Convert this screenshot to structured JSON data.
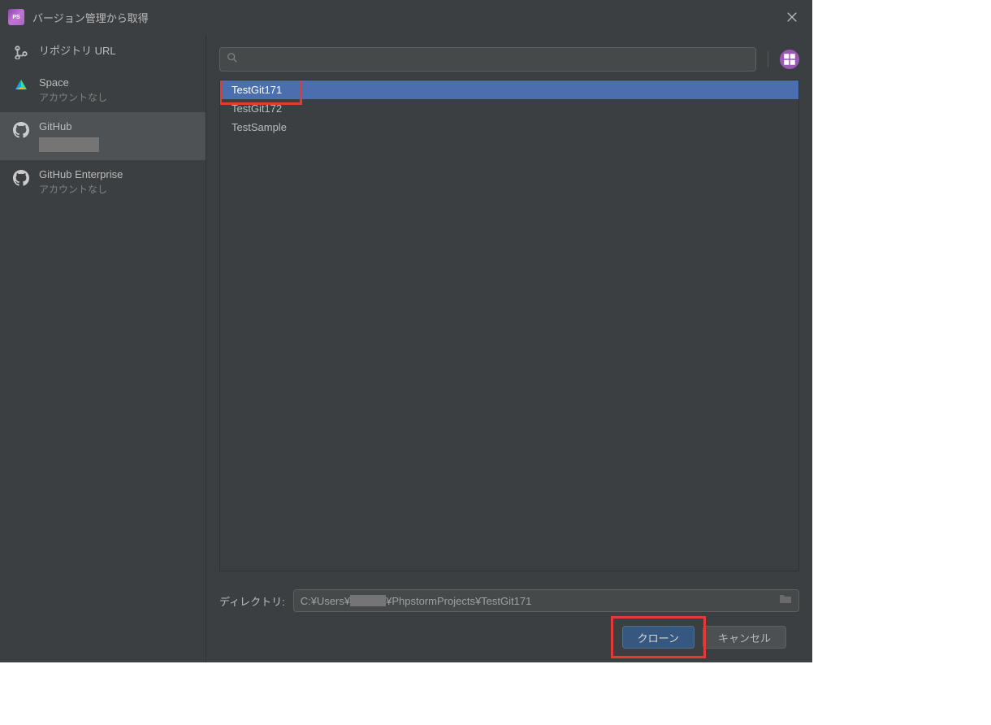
{
  "dialog": {
    "title": "バージョン管理から取得"
  },
  "sidebar": {
    "items": [
      {
        "id": "repo-url",
        "title": "リポジトリ URL",
        "sub": null,
        "selected": false,
        "icon": "branch"
      },
      {
        "id": "space",
        "title": "Space",
        "sub": "アカウントなし",
        "selected": false,
        "icon": "space"
      },
      {
        "id": "github",
        "title": "GitHub",
        "sub": null,
        "selected": true,
        "icon": "github",
        "hasAccountPlaceholder": true
      },
      {
        "id": "github-ent",
        "title": "GitHub Enterprise",
        "sub": "アカウントなし",
        "selected": false,
        "icon": "github"
      }
    ]
  },
  "search": {
    "placeholder": ""
  },
  "repos": [
    {
      "name": "TestGit171",
      "selected": true,
      "highlight": true
    },
    {
      "name": "TestGit172",
      "selected": false
    },
    {
      "name": "TestSample",
      "selected": false
    }
  ],
  "directory": {
    "label": "ディレクトリ:",
    "value_pre": "C:¥Users¥",
    "value_post": "¥PhpstormProjects¥TestGit171"
  },
  "buttons": {
    "clone": "クローン",
    "cancel": "キャンセル"
  }
}
